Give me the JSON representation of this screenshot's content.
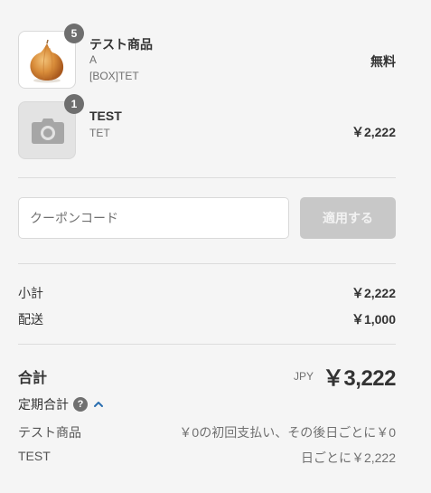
{
  "line_items": [
    {
      "name": "テスト商品",
      "variant": "A",
      "sku": "[BOX]TET",
      "quantity": "5",
      "price": "無料",
      "image": "onion-photo"
    },
    {
      "name": "TEST",
      "variant": "TET",
      "quantity": "1",
      "price": "￥2,222",
      "image": "camera-icon"
    }
  ],
  "coupon": {
    "placeholder": "クーポンコード",
    "value": "",
    "button_label": "適用する"
  },
  "summary": {
    "subtotal_label": "小計",
    "subtotal_value": "￥2,222",
    "shipping_label": "配送",
    "shipping_value": "￥1,000"
  },
  "total": {
    "label": "合計",
    "currency": "JPY",
    "value": "￥3,222"
  },
  "subscription": {
    "label": "定期合計",
    "help_glyph": "?",
    "expanded": true,
    "items": [
      {
        "name": "テスト商品",
        "detail": "￥0の初回支払い、その後日ごとに￥0"
      },
      {
        "name": "TEST",
        "detail": "日ごとに￥2,222"
      }
    ]
  },
  "colors": {
    "background": "#f5f5f5",
    "text": "#333333",
    "muted": "#707070",
    "accent": "#2a6fb0",
    "disabled_button": "#c8c8c8"
  }
}
